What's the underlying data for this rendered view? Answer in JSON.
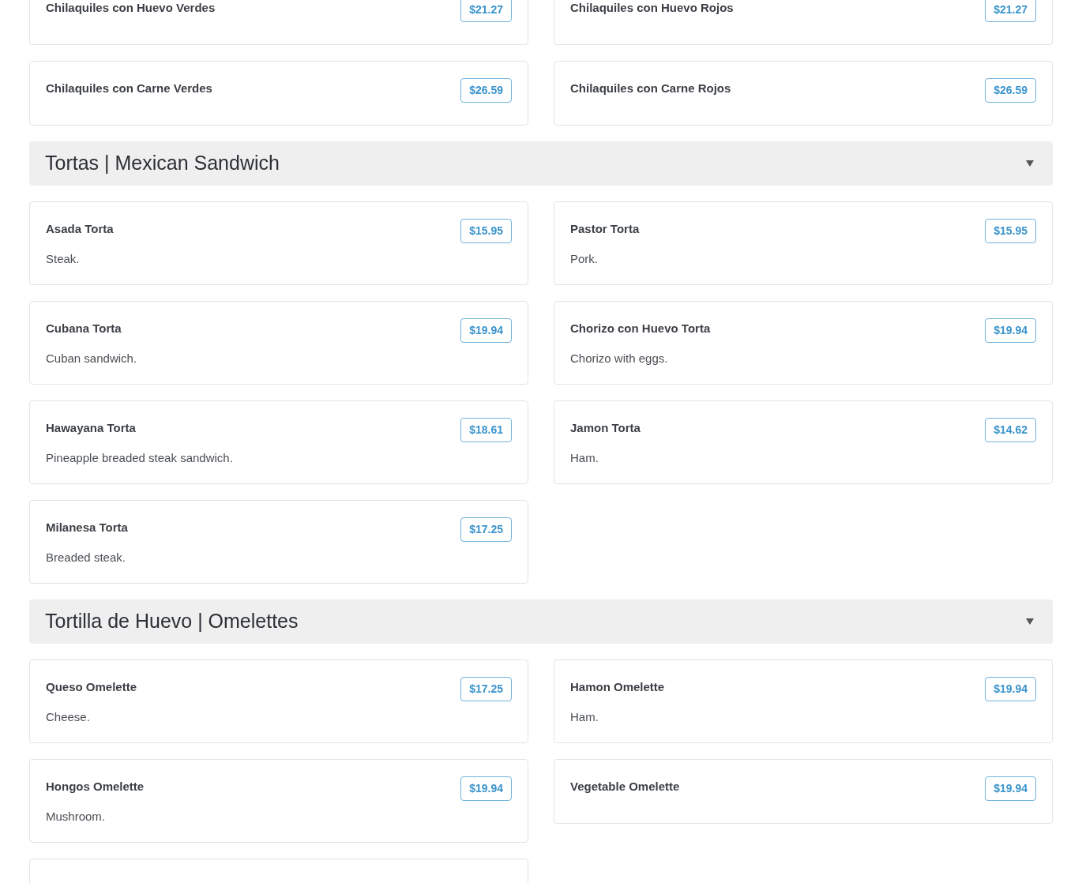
{
  "sections": [
    {
      "items": [
        {
          "name": "Chilaquiles con Huevo Verdes",
          "price": "$21.27"
        },
        {
          "name": "Chilaquiles con Huevo Rojos",
          "price": "$21.27"
        },
        {
          "name": "Chilaquiles con Carne Verdes",
          "price": "$26.59"
        },
        {
          "name": "Chilaquiles con Carne Rojos",
          "price": "$26.59"
        }
      ]
    },
    {
      "title": "Tortas | Mexican Sandwich",
      "expanded": true,
      "items": [
        {
          "name": "Asada Torta",
          "price": "$15.95",
          "description": "Steak."
        },
        {
          "name": "Pastor Torta",
          "price": "$15.95",
          "description": "Pork."
        },
        {
          "name": "Cubana Torta",
          "price": "$19.94",
          "description": "Cuban sandwich."
        },
        {
          "name": "Chorizo con Huevo Torta",
          "price": "$19.94",
          "description": "Chorizo with eggs."
        },
        {
          "name": "Hawayana Torta",
          "price": "$18.61",
          "description": "Pineapple breaded steak sandwich."
        },
        {
          "name": "Jamon Torta",
          "price": "$14.62",
          "description": "Ham."
        },
        {
          "name": "Milanesa Torta",
          "price": "$17.25",
          "description": "Breaded steak."
        }
      ]
    },
    {
      "title": "Tortilla de Huevo | Omelettes",
      "expanded": true,
      "items": [
        {
          "name": "Queso Omelette",
          "price": "$17.25",
          "description": "Cheese."
        },
        {
          "name": "Hamon Omelette",
          "price": "$19.94",
          "description": "Ham."
        },
        {
          "name": "Hongos Omelette",
          "price": "$19.94",
          "description": "Mushroom."
        },
        {
          "name": "Vegetable Omelette",
          "price": "$19.94"
        },
        {
          "kind": "cut"
        }
      ]
    }
  ]
}
